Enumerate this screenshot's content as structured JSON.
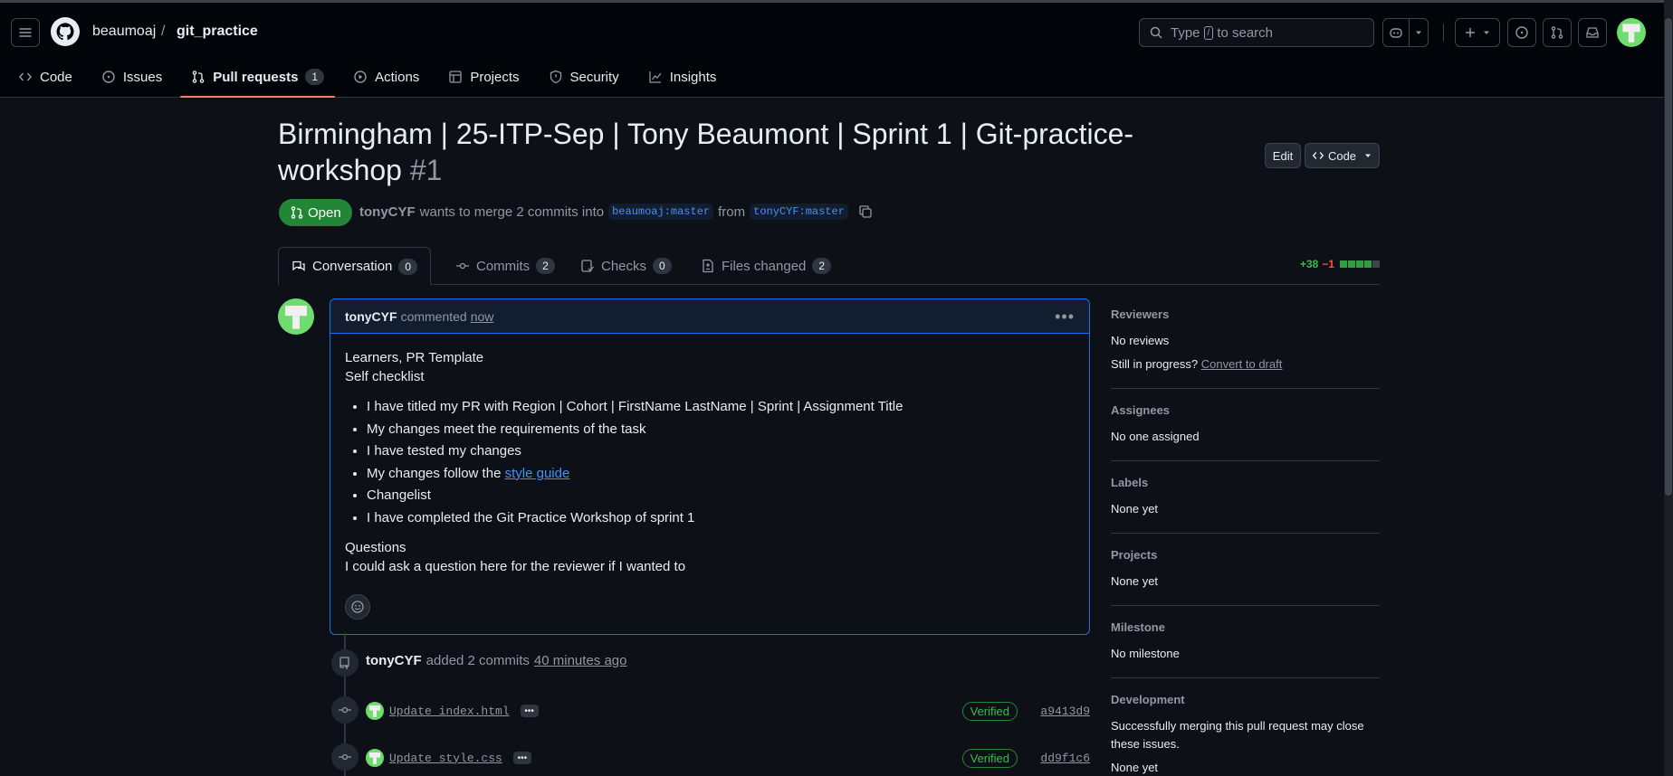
{
  "header": {
    "owner": "beaumoaj",
    "separator": "/",
    "repo": "git_practice",
    "search_prefix": "Type",
    "search_key": "/",
    "search_suffix": "to search"
  },
  "repo_nav": [
    {
      "label": "Code",
      "icon": "code-icon"
    },
    {
      "label": "Issues",
      "icon": "issue-icon"
    },
    {
      "label": "Pull requests",
      "icon": "pull-request-icon",
      "count": "1"
    },
    {
      "label": "Actions",
      "icon": "play-icon"
    },
    {
      "label": "Projects",
      "icon": "table-icon"
    },
    {
      "label": "Security",
      "icon": "shield-icon"
    },
    {
      "label": "Insights",
      "icon": "graph-icon"
    }
  ],
  "pr": {
    "title": "Birmingham | 25-ITP-Sep | Tony Beaumont | Sprint 1 | Git-practice-workshop",
    "number": "#1",
    "edit_label": "Edit",
    "code_label": "Code",
    "state": "Open",
    "author": "tonyCYF",
    "merge_text": "wants to merge 2 commits into",
    "base_branch": "beaumoaj:master",
    "from_text": "from",
    "head_branch": "tonyCYF:master"
  },
  "tabs": [
    {
      "label": "Conversation",
      "count": "0"
    },
    {
      "label": "Commits",
      "count": "2"
    },
    {
      "label": "Checks",
      "count": "0"
    },
    {
      "label": "Files changed",
      "count": "2"
    }
  ],
  "diffstat": {
    "additions": "+38",
    "deletions": "−1",
    "blocks_green": 4,
    "blocks_total": 5
  },
  "comment": {
    "author": "tonyCYF",
    "action": "commented",
    "when": "now",
    "line1": "Learners, PR Template",
    "line2": "Self checklist",
    "items": [
      "I have titled my PR with Region | Cohort | FirstName LastName | Sprint | Assignment Title",
      "My changes meet the requirements of the task",
      "I have tested my changes",
      "Changelist",
      "I have completed the Git Practice Workshop of sprint 1"
    ],
    "style_item_prefix": "My changes follow the",
    "style_item_link": "style guide",
    "questions_title": "Questions",
    "questions_text": "I could ask a question here for the reviewer if I wanted to"
  },
  "event": {
    "author": "tonyCYF",
    "action": "added 2 commits",
    "when": "40 minutes ago"
  },
  "commits": [
    {
      "message": "Update index.html",
      "verified": "Verified",
      "sha": "a9413d9"
    },
    {
      "message": "Update style.css",
      "verified": "Verified",
      "sha": "dd9f1c6"
    }
  ],
  "sidebar": {
    "reviewers_title": "Reviewers",
    "reviewers_value": "No reviews",
    "progress_prefix": "Still in progress?",
    "progress_link": "Convert to draft",
    "assignees_title": "Assignees",
    "assignees_value": "No one assigned",
    "labels_title": "Labels",
    "labels_value": "None yet",
    "projects_title": "Projects",
    "projects_value": "None yet",
    "milestone_title": "Milestone",
    "milestone_value": "No milestone",
    "development_title": "Development",
    "development_text": "Successfully merging this pull request may close these issues.",
    "development_value": "None yet"
  },
  "colors": {
    "accent": "#1f6feb",
    "open": "#238636",
    "underline": "#f78166"
  }
}
